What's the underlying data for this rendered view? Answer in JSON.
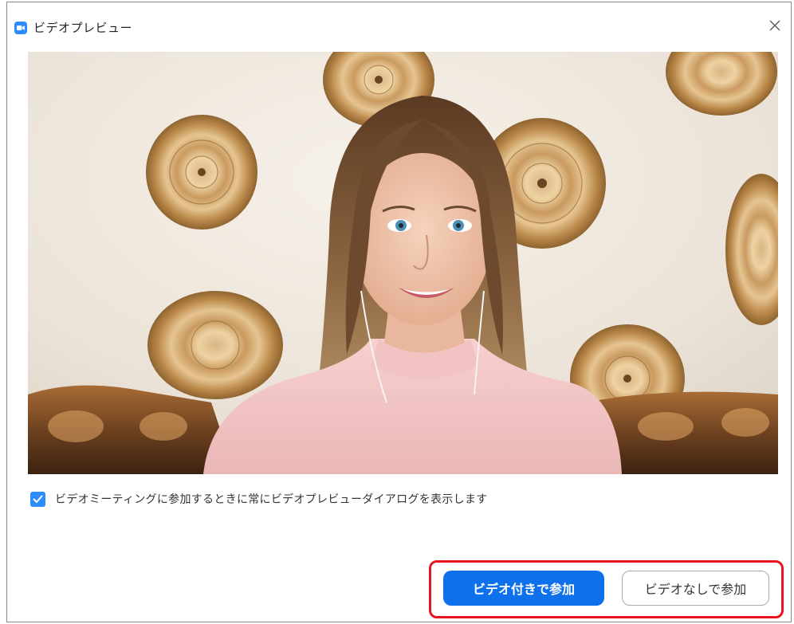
{
  "window": {
    "title": "ビデオプレビュー",
    "accent_color": "#2d8cff"
  },
  "preview": {
    "image": "video-preview-woman-smiling"
  },
  "checkbox": {
    "checked": true,
    "label": "ビデオミーティングに参加するときに常にビデオプレビューダイアログを表示します"
  },
  "buttons": {
    "join_with_video": "ビデオ付きで参加",
    "join_without_video": "ビデオなしで参加"
  },
  "colors": {
    "primary_button": "#0e71eb",
    "highlight": "#e8141e"
  }
}
